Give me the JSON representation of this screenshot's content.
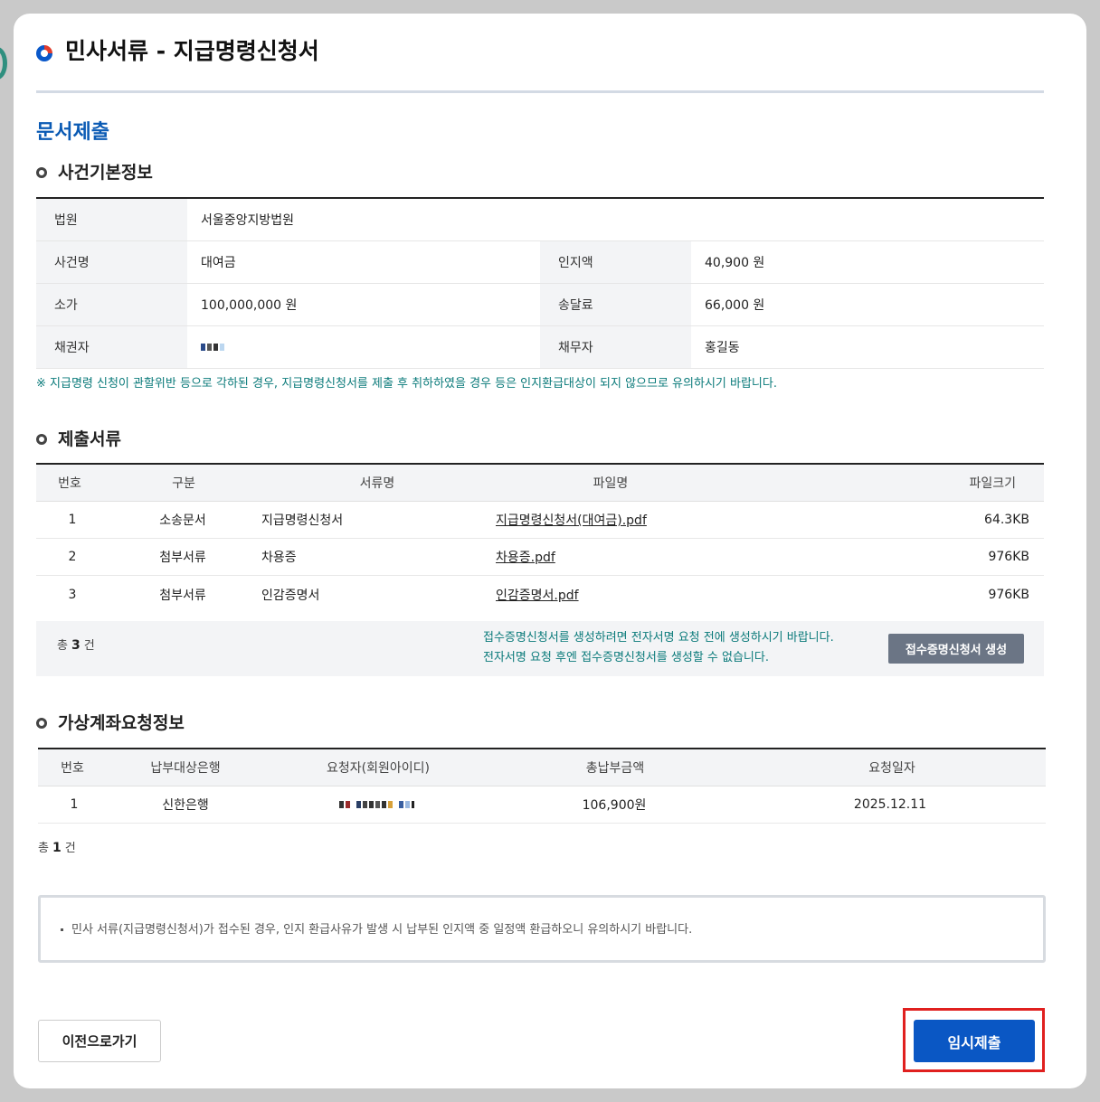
{
  "page_title": "민사서류 - 지급명령신청서",
  "section_main": "문서제출",
  "case_info": {
    "title": "사건기본정보",
    "court_label": "법원",
    "court_value": "서울중앙지방법원",
    "case_name_label": "사건명",
    "case_name_value": "대여금",
    "stamp_label": "인지액",
    "stamp_value": "40,900 원",
    "amount_label": "소가",
    "amount_value": "100,000,000 원",
    "postage_label": "송달료",
    "postage_value": "66,000 원",
    "creditor_label": "채권자",
    "debtor_label": "채무자",
    "debtor_value": "홍길동",
    "notice": "※ 지급명령 신청이 관할위반 등으로 각하된 경우, 지급명령신청서를 제출 후 취하하였을 경우 등은 인지환급대상이 되지 않으므로 유의하시기 바랍니다."
  },
  "documents": {
    "title": "제출서류",
    "headers": {
      "no": "번호",
      "type": "구분",
      "doc_name": "서류명",
      "file_name": "파일명",
      "file_size": "파일크기"
    },
    "rows": [
      {
        "no": "1",
        "type": "소송문서",
        "doc_name": "지급명령신청서",
        "file_name": "지급명령신청서(대여금).pdf",
        "file_size": "64.3KB"
      },
      {
        "no": "2",
        "type": "첨부서류",
        "doc_name": "차용증",
        "file_name": "차용증.pdf",
        "file_size": "976KB"
      },
      {
        "no": "3",
        "type": "첨부서류",
        "doc_name": "인감증명서",
        "file_name": "인감증명서.pdf",
        "file_size": "976KB"
      }
    ],
    "count_prefix": "총",
    "count": "3",
    "count_suffix": "건",
    "receipt_msg_1": "접수증명신청서를 생성하려면 전자서명 요청 전에 생성하시기 바랍니다.",
    "receipt_msg_2": "전자서명 요청 후엔 접수증명신청서를 생성할 수 없습니다.",
    "receipt_button": "접수증명신청서 생성"
  },
  "virtual_account": {
    "title": "가상계좌요청정보",
    "headers": {
      "no": "번호",
      "bank": "납부대상은행",
      "requester": "요청자(회원아이디)",
      "total": "총납부금액",
      "date": "요청일자"
    },
    "rows": [
      {
        "no": "1",
        "bank": "신한은행",
        "total": "106,900원",
        "date": "2025.12.11"
      }
    ],
    "count_prefix": "총",
    "count": "1",
    "count_suffix": "건"
  },
  "info_notice": "민사 서류(지급명령신청서)가 접수된 경우, 인지 환급사유가 발생 시 납부된 인지액 중 일정액 환급하오니 유의하시기 바랍니다.",
  "buttons": {
    "prev": "이전으로가기",
    "submit": "임시제출"
  },
  "colors": {
    "accent_blue": "#0a57c4",
    "notice_teal": "#0a7a7a",
    "highlight_red": "#e0201f"
  }
}
